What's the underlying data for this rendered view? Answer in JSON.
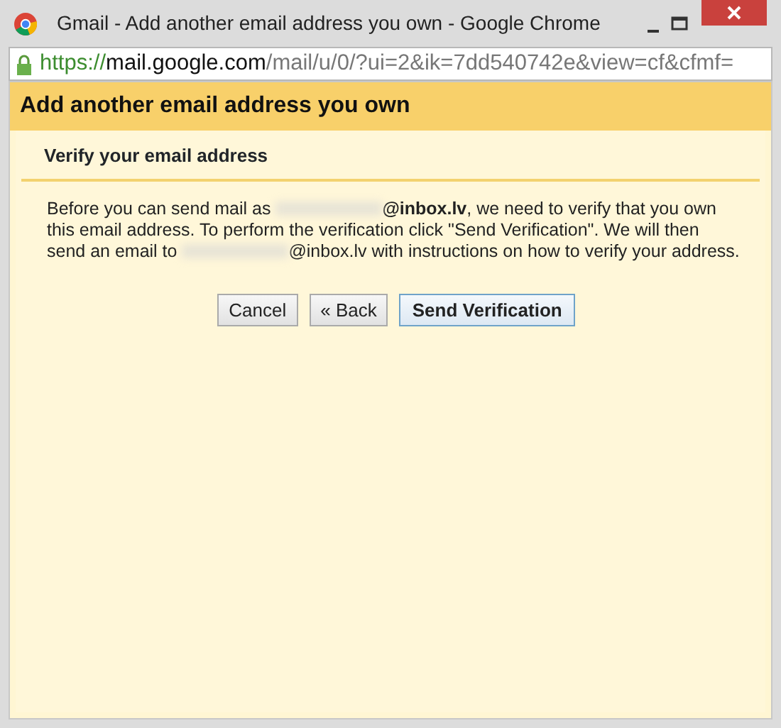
{
  "window": {
    "title": "Gmail - Add another email address you own - Google Chrome"
  },
  "address_bar": {
    "scheme": "https://",
    "host": "mail.google.com",
    "path": "/mail/u/0/?ui=2&ik=7dd540742e&view=cf&cfmf="
  },
  "dialog": {
    "title": "Add another email address you own",
    "subtitle": "Verify your email address",
    "message_parts": [
      "Before you can send mail as ",
      "**@inbox.lv**, we need to verify that you own this email address. To perform the verification click \"Send Verification\". We will then send an email to ",
      "@inbox.lv with instructions on how to verify your address."
    ],
    "buttons": [
      {
        "label": "Cancel",
        "primary": false
      },
      {
        "label": "« Back",
        "primary": false
      },
      {
        "label": "Send Verification",
        "primary": true
      }
    ]
  }
}
